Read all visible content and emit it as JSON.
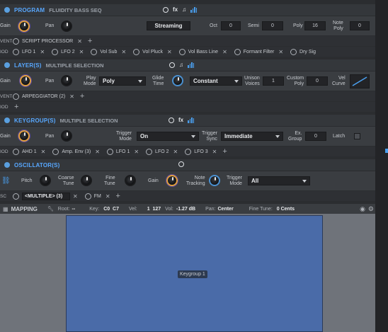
{
  "program": {
    "title": "PROGRAM",
    "subtitle": "FLUIDITY BASS SEQ",
    "gain": "Gain",
    "pan": "Pan",
    "preset": "Streaming",
    "oct_l": "Oct",
    "oct_v": "0",
    "semi_l": "Semi",
    "semi_v": "0",
    "poly_l": "Poly",
    "poly_v": "16",
    "note_poly_l": "Note\nPoly",
    "note_poly_v": "0",
    "fx": "fx"
  },
  "event_strip": {
    "tag": "VENT",
    "item": "SCRIPT PROCESSOR"
  },
  "mod_strip": {
    "tag": "IOD",
    "items": [
      "LFO 1",
      "LFO 2",
      "Vol Sub",
      "Vol Pluck",
      "Vol Bass Line",
      "Formant Filter",
      "Dry Sig"
    ]
  },
  "layers": {
    "title": "LAYER(S)",
    "subtitle": "MULTIPLE SELECTION",
    "gain": "Gain",
    "pan": "Pan",
    "play_mode_l": "Play\nMode",
    "play_mode_v": "Poly",
    "glide_l": "Glide\nTime",
    "glide_v": "Constant",
    "unison_l": "Unison\nVoices",
    "unison_v": "1",
    "custom_poly_l": "Custom\nPoly",
    "custom_poly_v": "0",
    "vel_curve_l": "Vel\nCurve"
  },
  "layers_event": {
    "tag": "VENT",
    "item": "ARPEGGIATOR (2)"
  },
  "layers_mod": {
    "tag": "IOD"
  },
  "keygroups": {
    "title": "KEYGROUP(S)",
    "subtitle": "MULTIPLE SELECTION",
    "gain": "Gain",
    "pan": "Pan",
    "trigger_mode_l": "Trigger\nMode",
    "trigger_mode_v": "On",
    "trigger_sync_l": "Trigger\nSync",
    "trigger_sync_v": "Immediate",
    "ex_group_l": "Ex.\nGroup",
    "ex_group_v": "0",
    "latch_l": "Latch"
  },
  "kg_mod": {
    "tag": "IOD",
    "items": [
      "AHD 1",
      "Amp. Env (3)",
      "LFO 1",
      "LFO 2",
      "LFO 3"
    ]
  },
  "oscillators": {
    "title": "OSCILLATOR(S)",
    "pitch": "Pitch",
    "coarse_l": "Coarse\nTune",
    "fine_l": "Fine\nTune",
    "gain": "Gain",
    "note_tracking_l": "Note\nTracking",
    "trigger_mode_l": "Trigger\nMode",
    "trigger_mode_v": "All"
  },
  "osc_strip": {
    "tag": "SC",
    "multiple": "<MULTIPLE> (3)",
    "fm": "FM"
  },
  "mapping": {
    "title": "MAPPING",
    "root_l": "Root:",
    "root_v": "--",
    "key_l": "Key:",
    "key_v": "C0  C7",
    "vel_l": "Vel:",
    "vel_v": "1  127",
    "vol_l": "Vol:",
    "vol_v": "-1.27 dB",
    "pan_l": "Pan:",
    "pan_v": "Center",
    "fine_l": "Fine Tune:",
    "fine_v": "0 Cents",
    "keygroup_label": "Keygroup 1"
  },
  "colors": {
    "accent": "#58a8ff",
    "map_block": "#4a6ba8",
    "knob_ring": "#e2a040"
  }
}
